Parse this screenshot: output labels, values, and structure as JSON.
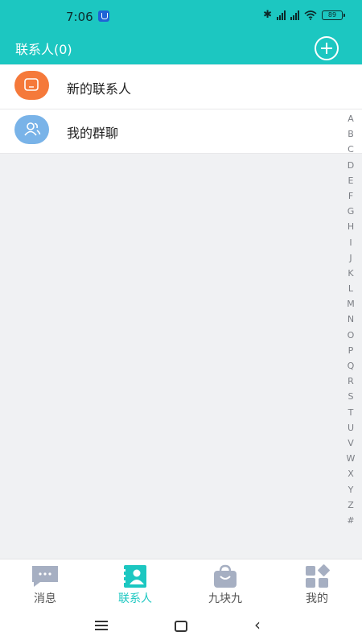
{
  "status_bar": {
    "time": "7:06",
    "battery": "89",
    "icons": [
      "app-shield-icon",
      "bluetooth-icon",
      "hd-signal-icon",
      "hd-signal-icon",
      "wifi-icon",
      "battery-icon"
    ]
  },
  "header": {
    "title": "联系人(0)",
    "add_icon": "add-circle-icon"
  },
  "list": [
    {
      "label": "新的联系人",
      "icon": "new-contact-icon",
      "color": "#f5793a"
    },
    {
      "label": "我的群聊",
      "icon": "group-chat-icon",
      "color": "#79b3e8"
    }
  ],
  "alphabet": [
    "A",
    "B",
    "C",
    "D",
    "E",
    "F",
    "G",
    "H",
    "I",
    "J",
    "K",
    "L",
    "M",
    "N",
    "O",
    "P",
    "Q",
    "R",
    "S",
    "T",
    "U",
    "V",
    "W",
    "X",
    "Y",
    "Z",
    "#"
  ],
  "tabs": [
    {
      "label": "消息",
      "icon": "message-icon",
      "active": false
    },
    {
      "label": "联系人",
      "icon": "contacts-icon",
      "active": true
    },
    {
      "label": "九块九",
      "icon": "shopping-bag-icon",
      "active": false
    },
    {
      "label": "我的",
      "icon": "apps-icon",
      "active": false
    }
  ],
  "colors": {
    "accent": "#1cc7c1",
    "new_contact": "#f5793a",
    "group_chat": "#79b3e8",
    "inactive_icon": "#a6afc2"
  }
}
